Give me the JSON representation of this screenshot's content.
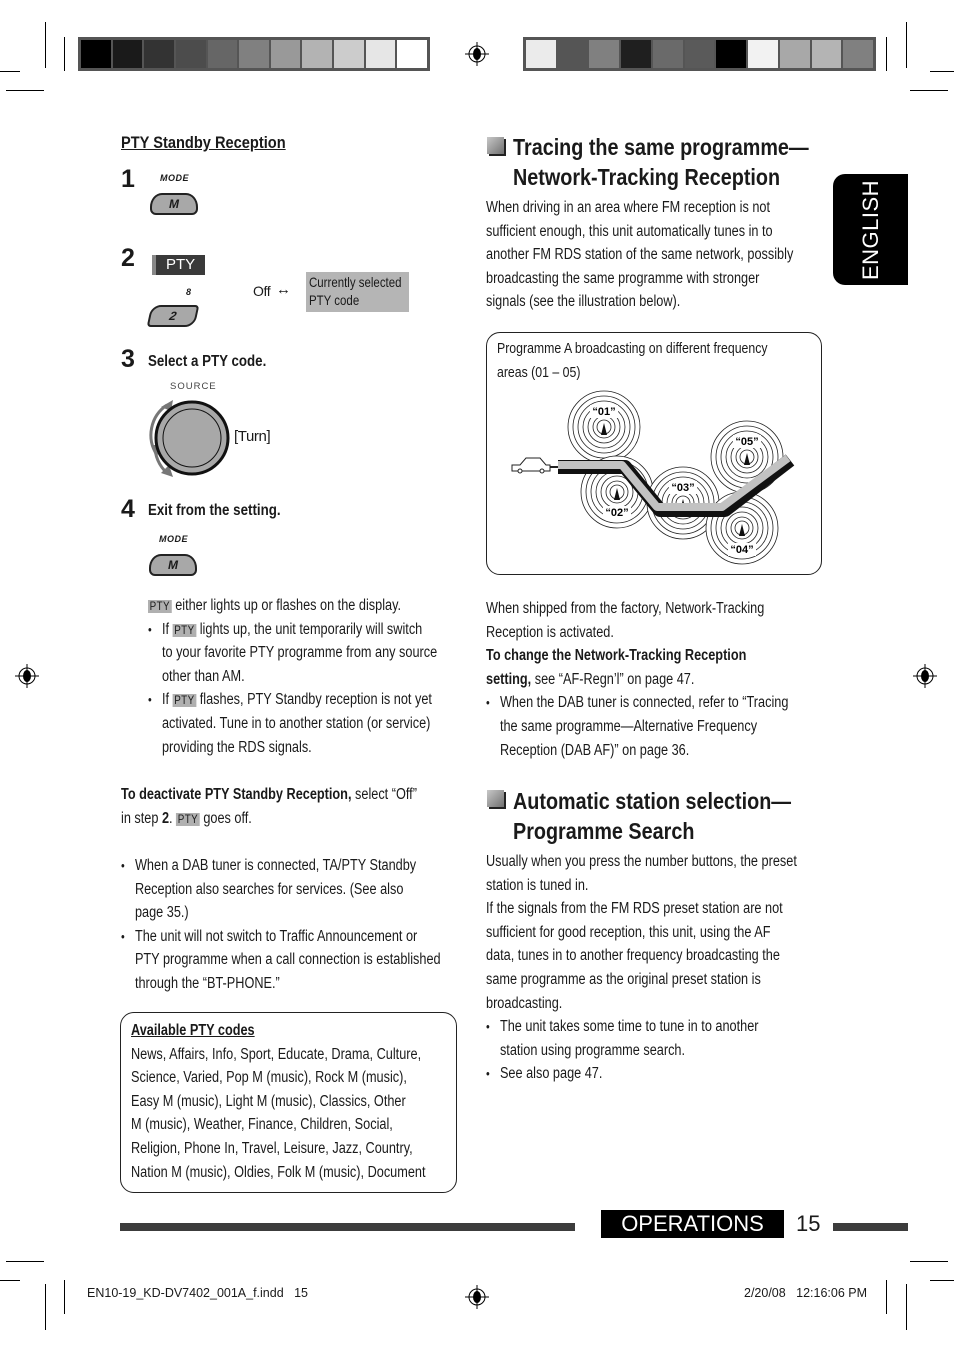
{
  "color_bars": {
    "left": [
      "#000000",
      "#1a1a1a",
      "#333333",
      "#4c4c4c",
      "#666666",
      "#808080",
      "#999999",
      "#b3b3b3",
      "#cccccc",
      "#e6e6e6",
      "#ffffff"
    ],
    "right": [
      "#ebebeb",
      "#555555",
      "#808080",
      "#1f1f1f",
      "#6a6a6a",
      "#5a5a5a",
      "#000000",
      "#f2f2f2",
      "#a8a8a8",
      "#b4b4b4",
      "#808080"
    ]
  },
  "left": {
    "heading": "PTY Standby Reception",
    "steps": [
      {
        "num": "1",
        "button_caption": "MODE",
        "button_label": "M"
      },
      {
        "num": "2",
        "display_label": "PTY",
        "button_caption": "8",
        "button_label": "2",
        "toggle_off": "Off",
        "toggle_arrow": "↔",
        "toggle_on_line1": "Currently selected",
        "toggle_on_line2": "PTY code"
      },
      {
        "num": "3",
        "label": "Select a PTY code.",
        "knob_caption": "SOURCE",
        "knob_action": "[Turn]"
      },
      {
        "num": "4",
        "label": "Exit from the setting.",
        "button_caption": "MODE",
        "button_label": "M"
      }
    ],
    "indicator_tag": "PTY",
    "indicator_text": "either lights up or flashes on the display.",
    "indicator_bullets": [
      {
        "pre": "If",
        "post_line1": "lights up, the unit temporarily will switch",
        "line2": "to your favorite PTY programme from any source",
        "line3": "other than AM."
      },
      {
        "pre": "If",
        "post_line1": "flashes, PTY Standby reception is not yet",
        "line2": "activated. Tune in to another station (or service)",
        "line3": "providing the RDS signals."
      }
    ],
    "deactivate": {
      "bold": "To deactivate PTY Standby Reception,",
      "rest": " select “Off”",
      "line2_pre": "in step ",
      "line2_bold": "2",
      "line2_mid": ". ",
      "line2_post": " goes off."
    },
    "notes": [
      [
        "When a DAB tuner is connected, TA/PTY Standby",
        "Reception also searches for services. (See also",
        "page 35.)"
      ],
      [
        "The unit will not switch to Traffic Announcement or",
        "PTY programme when a call connection is established",
        "through the “BT-PHONE.”"
      ]
    ],
    "codes_box": {
      "title": "Available PTY codes",
      "lines": [
        "News, Affairs, Info, Sport, Educate, Drama, Culture,",
        "Science, Varied, Pop M (music), Rock M (music),",
        "Easy M (music), Light M (music), Classics, Other",
        "M (music), Weather, Finance, Children, Social,",
        "Religion, Phone In, Travel, Leisure, Jazz, Country,",
        "Nation M (music), Oldies, Folk M (music), Document"
      ]
    }
  },
  "right": {
    "section1": {
      "title_line1": "Tracing the same programme—",
      "title_line2": "Network-Tracking Reception",
      "body": [
        "When driving in an area where FM reception is not",
        "sufficient enough, this unit automatically tunes in to",
        "another FM RDS station of the same network, possibly",
        "broadcasting the same programme with stronger",
        "signals (see the illustration below)."
      ],
      "illustration": {
        "caption_line1": "Programme A broadcasting on different frequency",
        "caption_line2": "areas (01 – 05)",
        "stations": [
          "“01”",
          "“02”",
          "“03”",
          "“04”",
          "“05”"
        ]
      },
      "after": [
        "When shipped from the factory, Network-Tracking",
        "Reception is activated."
      ],
      "change_bold_line1": "To change the Network-Tracking Reception",
      "change_bold_line2": "setting,",
      "change_rest": " see “AF-Regn’l” on page 47.",
      "bullet": [
        "When the DAB tuner is connected, refer to “Tracing",
        "the same programme—Alternative Frequency",
        "Reception (DAB AF)” on page 36."
      ]
    },
    "section2": {
      "title_line1": "Automatic station selection—",
      "title_line2": "Programme Search",
      "body": [
        "Usually when you press the number buttons, the preset",
        "station is tuned in.",
        "If the signals from the FM RDS preset station are not",
        "sufficient for good reception, this unit, using the AF",
        "data, tunes in to another frequency broadcasting the",
        "same programme as the original preset station is",
        "broadcasting."
      ],
      "bullets": [
        [
          "The unit takes some time to tune in to another",
          "station using programme search."
        ],
        [
          "See also page 47."
        ]
      ]
    }
  },
  "side_tab": "ENGLISH",
  "footer": {
    "section": "OPERATIONS",
    "page": "15",
    "slug_left": "EN10-19_KD-DV7402_001A_f.indd   15",
    "slug_right": "2/20/08   12:16:06 PM"
  }
}
